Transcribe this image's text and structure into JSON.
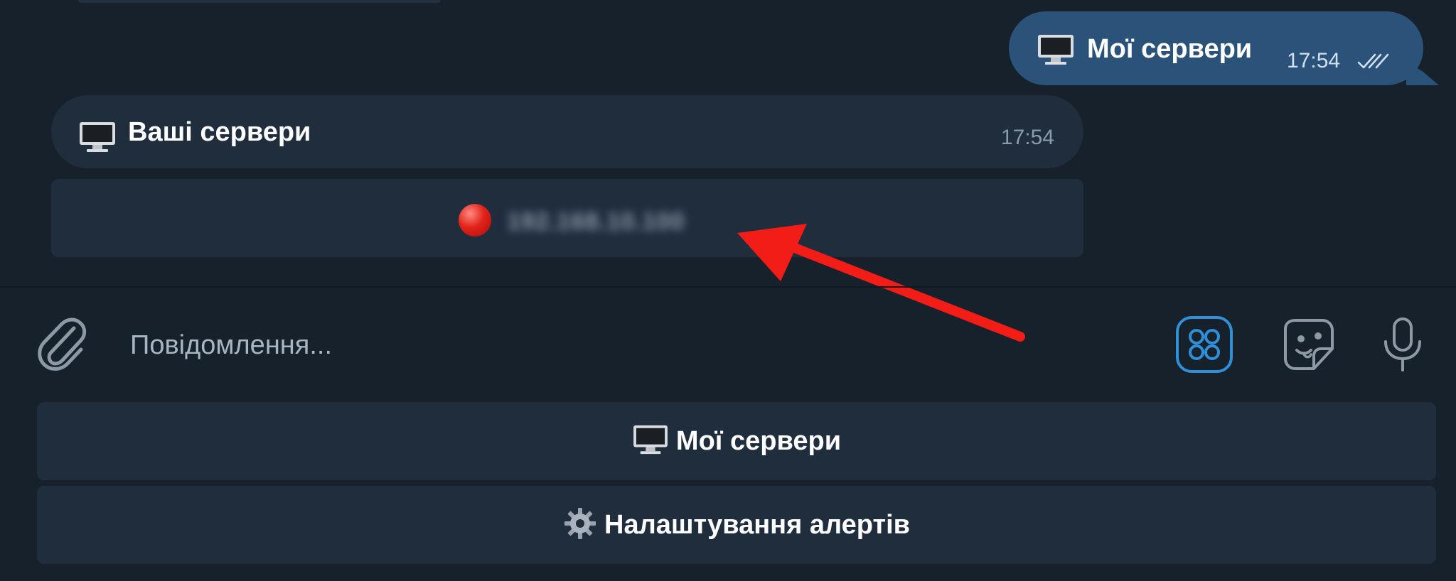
{
  "messages": {
    "outgoing": {
      "text": "Мої сервери",
      "time": "17:54",
      "icon": "desktop-computer-emoji",
      "status": "read-double-check"
    },
    "incoming": {
      "text": "Ваші сервери",
      "time": "17:54",
      "icon": "desktop-computer-emoji"
    },
    "inline_button": {
      "status_icon": "red-circle-emoji",
      "label": "192.168.10.100"
    }
  },
  "composer": {
    "placeholder": "Повідомлення...",
    "icons": [
      "paperclip-icon",
      "bot-keyboard-icon",
      "sticker-icon",
      "microphone-icon"
    ]
  },
  "keyboard": {
    "buttons": [
      {
        "icon": "desktop-computer-emoji",
        "label": "Мої сервери"
      },
      {
        "icon": "gear-emoji",
        "label": "Налаштування алертів"
      }
    ]
  },
  "colors": {
    "background": "#17212b",
    "outgoing_bubble": "#2b5278",
    "incoming_bubble": "#1f2d3d",
    "accent": "#2f8fd8",
    "annotation_arrow": "#f21d16"
  }
}
